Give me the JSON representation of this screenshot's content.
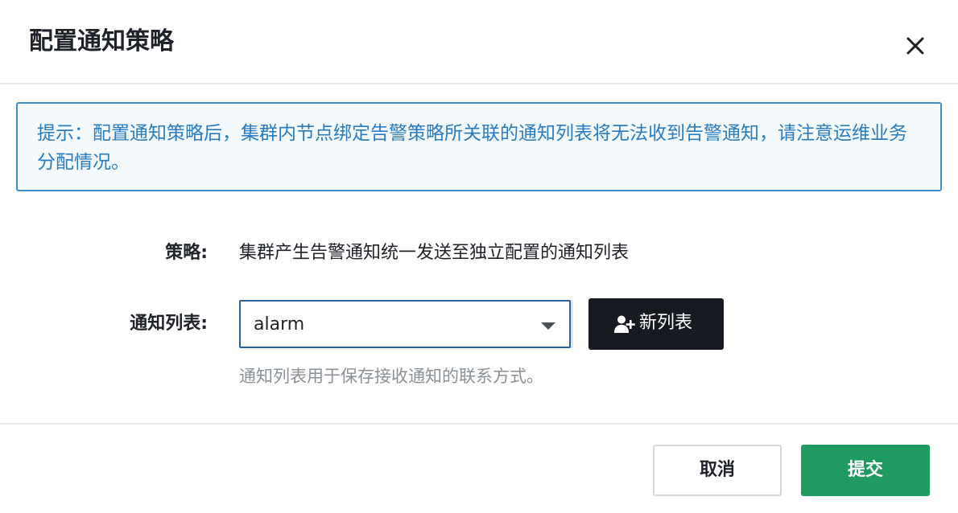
{
  "dialog": {
    "title": "配置通知策略"
  },
  "notice": {
    "text": "提示：配置通知策略后，集群内节点绑定告警策略所关联的通知列表将无法收到告警通知，请注意运维业务分配情况。"
  },
  "form": {
    "policy_label": "策略:",
    "policy_value": "集群产生告警通知统一发送至独立配置的通知列表",
    "list_label": "通知列表:",
    "list_selected": "alarm",
    "new_list_label": "新列表",
    "hint": "通知列表用于保存接收通知的联系方式。"
  },
  "footer": {
    "cancel_label": "取消",
    "submit_label": "提交"
  },
  "colors": {
    "notice_border": "#3f8ec8",
    "notice_text": "#2a7cc0",
    "primary_dark": "#171b21",
    "submit_green": "#1f9a60"
  },
  "icons": {
    "close": "close-icon",
    "add_user": "add-user-icon",
    "dropdown": "caret-down-icon"
  }
}
